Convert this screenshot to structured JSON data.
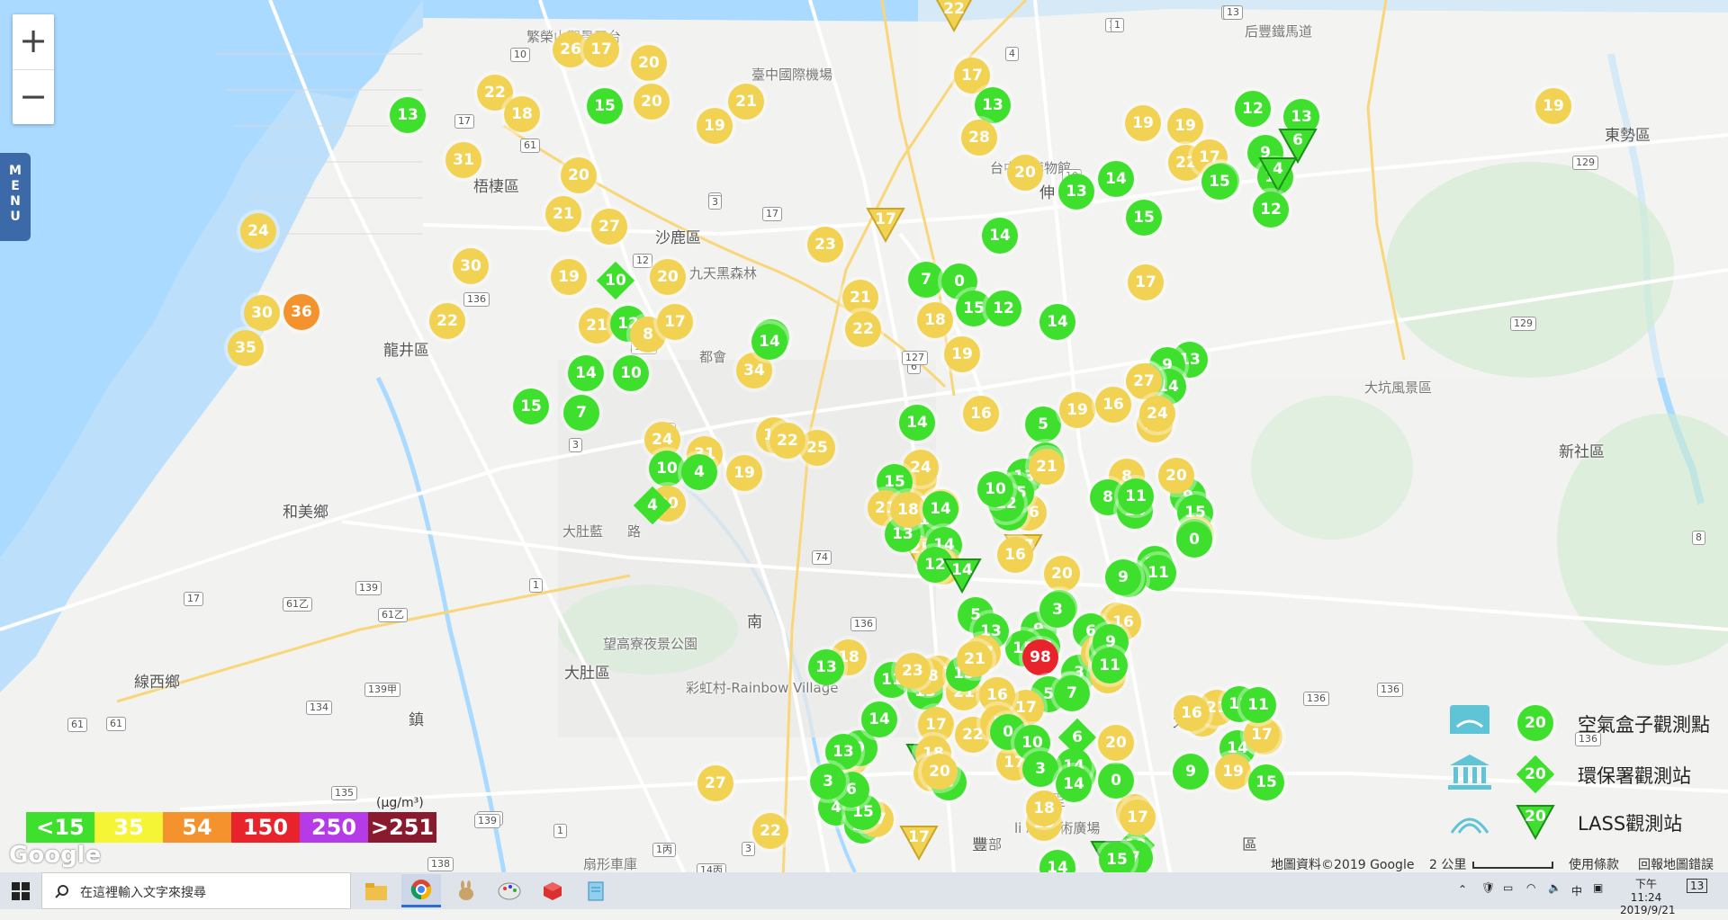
{
  "zoom": {
    "in_label": "+",
    "out_label": "−"
  },
  "menu": {
    "label": "MENU"
  },
  "places": [
    {
      "name": "繁榮山觀景平台",
      "cls": "small"
    },
    {
      "name": "臺中國際機場",
      "cls": "small"
    },
    {
      "name": "后豐鐵馬道",
      "cls": "small"
    },
    {
      "name": "東勢區",
      "cls": ""
    },
    {
      "name": "梧棲區",
      "cls": ""
    },
    {
      "name": "沙鹿區",
      "cls": ""
    },
    {
      "name": "台中球博物館",
      "cls": "small"
    },
    {
      "name": "九天黑森林",
      "cls": "small"
    },
    {
      "name": "龍井區",
      "cls": ""
    },
    {
      "name": "都會",
      "cls": "small"
    },
    {
      "name": "大坑風景區",
      "cls": "small"
    },
    {
      "name": "新社區",
      "cls": ""
    },
    {
      "name": "大肚藍",
      "cls": "small"
    },
    {
      "name": "路",
      "cls": "small"
    },
    {
      "name": "和美鄉",
      "cls": ""
    },
    {
      "name": "南",
      "cls": ""
    },
    {
      "name": "望高寮夜景公園",
      "cls": "small"
    },
    {
      "name": "大肚區",
      "cls": ""
    },
    {
      "name": "彩虹村-Rainbow Village",
      "cls": "small"
    },
    {
      "name": "線西鄉",
      "cls": ""
    },
    {
      "name": "鎮",
      "cls": ""
    },
    {
      "name": "太平",
      "cls": ""
    },
    {
      "name": "大里",
      "cls": ""
    },
    {
      "name": "li Art藝術廣場",
      "cls": "small"
    },
    {
      "name": "濟部",
      "cls": "small"
    },
    {
      "name": "扇形車庫",
      "cls": "small"
    },
    {
      "name": "伸",
      "cls": ""
    },
    {
      "name": "豐",
      "cls": ""
    },
    {
      "name": "區",
      "cls": ""
    }
  ],
  "shields": [
    "10",
    "17",
    "61",
    "136",
    "12",
    "1",
    "3",
    "17",
    "6",
    "127",
    "136",
    "12",
    "3",
    "74",
    "136",
    "1",
    "139",
    "61乙",
    "61乙",
    "17",
    "61",
    "134",
    "139甲",
    "135",
    "139",
    "1",
    "138",
    "1丙",
    "14丙",
    "3",
    "139",
    "129",
    "129",
    "136",
    "136",
    "136",
    "8",
    "13",
    "10",
    "4",
    "1",
    "3",
    "13",
    "61"
  ],
  "markers": [
    {
      "v": "26",
      "c": "y",
      "s": "c"
    },
    {
      "v": "17",
      "c": "y",
      "s": "c"
    },
    {
      "v": "20",
      "c": "y",
      "s": "c"
    },
    {
      "v": "20",
      "c": "y",
      "s": "c"
    },
    {
      "v": "21",
      "c": "y",
      "s": "c"
    },
    {
      "v": "19",
      "c": "y",
      "s": "c"
    },
    {
      "v": "22",
      "c": "y",
      "s": "c"
    },
    {
      "v": "18",
      "c": "y",
      "s": "c"
    },
    {
      "v": "13",
      "c": "g",
      "s": "c"
    },
    {
      "v": "15",
      "c": "g",
      "s": "c"
    },
    {
      "v": "31",
      "c": "y",
      "s": "c"
    },
    {
      "v": "20",
      "c": "y",
      "s": "c"
    },
    {
      "v": "21",
      "c": "y",
      "s": "c"
    },
    {
      "v": "27",
      "c": "y",
      "s": "c"
    },
    {
      "v": "24",
      "c": "y",
      "s": "c"
    },
    {
      "v": "30",
      "c": "y",
      "s": "c"
    },
    {
      "v": "19",
      "c": "y",
      "s": "c"
    },
    {
      "v": "10",
      "c": "g",
      "s": "d"
    },
    {
      "v": "20",
      "c": "y",
      "s": "c"
    },
    {
      "v": "30",
      "c": "y",
      "s": "c"
    },
    {
      "v": "36",
      "c": "o",
      "s": "c"
    },
    {
      "v": "35",
      "c": "y",
      "s": "c"
    },
    {
      "v": "22",
      "c": "y",
      "s": "c"
    },
    {
      "v": "21",
      "c": "y",
      "s": "c"
    },
    {
      "v": "12",
      "c": "g",
      "s": "c"
    },
    {
      "v": "8",
      "c": "y",
      "s": "c"
    },
    {
      "v": "17",
      "c": "y",
      "s": "c"
    },
    {
      "v": "15",
      "c": "g",
      "s": "c"
    },
    {
      "v": "10",
      "c": "g",
      "s": "c"
    },
    {
      "v": "14",
      "c": "g",
      "s": "c"
    },
    {
      "v": "15",
      "c": "g",
      "s": "c"
    },
    {
      "v": "7",
      "c": "g",
      "s": "c"
    },
    {
      "v": "19",
      "c": "y",
      "s": "c"
    },
    {
      "v": "34",
      "c": "y",
      "s": "c"
    },
    {
      "v": "14",
      "c": "g",
      "s": "c"
    },
    {
      "v": "22",
      "c": "y",
      "s": "t"
    },
    {
      "v": "17",
      "c": "y",
      "s": "c"
    },
    {
      "v": "13",
      "c": "g",
      "s": "c"
    },
    {
      "v": "28",
      "c": "y",
      "s": "c"
    },
    {
      "v": "20",
      "c": "y",
      "s": "c"
    },
    {
      "v": "13",
      "c": "g",
      "s": "c"
    },
    {
      "v": "19",
      "c": "y",
      "s": "c"
    },
    {
      "v": "19",
      "c": "y",
      "s": "c"
    },
    {
      "v": "22",
      "c": "y",
      "s": "c"
    },
    {
      "v": "12",
      "c": "g",
      "s": "c"
    },
    {
      "v": "13",
      "c": "g",
      "s": "c"
    },
    {
      "v": "9",
      "c": "g",
      "s": "c"
    },
    {
      "v": "6",
      "c": "g",
      "s": "t"
    },
    {
      "v": "17",
      "c": "y",
      "s": "c"
    },
    {
      "v": "13",
      "c": "g",
      "s": "c"
    },
    {
      "v": "12",
      "c": "g",
      "s": "c"
    },
    {
      "v": "4",
      "c": "g",
      "s": "t"
    },
    {
      "v": "12",
      "c": "g",
      "s": "c"
    },
    {
      "v": "15",
      "c": "g",
      "s": "c"
    },
    {
      "v": "15",
      "c": "g",
      "s": "c"
    },
    {
      "v": "14",
      "c": "g",
      "s": "c"
    },
    {
      "v": "19",
      "c": "y",
      "s": "c"
    },
    {
      "v": "23",
      "c": "y",
      "s": "c"
    },
    {
      "v": "17",
      "c": "y",
      "s": "t"
    },
    {
      "v": "14",
      "c": "g",
      "s": "c"
    },
    {
      "v": "7",
      "c": "g",
      "s": "c"
    },
    {
      "v": "0",
      "c": "g",
      "s": "c"
    },
    {
      "v": "21",
      "c": "y",
      "s": "c"
    },
    {
      "v": "22",
      "c": "y",
      "s": "c"
    },
    {
      "v": "15",
      "c": "g",
      "s": "c"
    },
    {
      "v": "12",
      "c": "g",
      "s": "c"
    },
    {
      "v": "18",
      "c": "y",
      "s": "c"
    },
    {
      "v": "19",
      "c": "y",
      "s": "c"
    },
    {
      "v": "14",
      "c": "g",
      "s": "c"
    },
    {
      "v": "17",
      "c": "y",
      "s": "c"
    },
    {
      "v": "13",
      "c": "g",
      "s": "c"
    },
    {
      "v": "9",
      "c": "g",
      "s": "c"
    },
    {
      "v": "14",
      "c": "g",
      "s": "c"
    },
    {
      "v": "14",
      "c": "g",
      "s": "c"
    },
    {
      "v": "27",
      "c": "y",
      "s": "c"
    },
    {
      "v": "16",
      "c": "y",
      "s": "c"
    },
    {
      "v": "5",
      "c": "g",
      "s": "c"
    },
    {
      "v": "19",
      "c": "y",
      "s": "c"
    },
    {
      "v": "16",
      "c": "y",
      "s": "c"
    },
    {
      "v": "17",
      "c": "y",
      "s": "c"
    },
    {
      "v": "14",
      "c": "g",
      "s": "c"
    },
    {
      "v": "19",
      "c": "y",
      "s": "c"
    },
    {
      "v": "31",
      "c": "y",
      "s": "c"
    },
    {
      "v": "24",
      "c": "y",
      "s": "c"
    },
    {
      "v": "10",
      "c": "g",
      "s": "c"
    },
    {
      "v": "4",
      "c": "g",
      "s": "c"
    },
    {
      "v": "8",
      "c": "y",
      "s": "c"
    },
    {
      "v": "24",
      "c": "y",
      "s": "c"
    },
    {
      "v": "25",
      "c": "y",
      "s": "c"
    },
    {
      "v": "22",
      "c": "y",
      "s": "c"
    },
    {
      "v": "19",
      "c": "y",
      "s": "c"
    },
    {
      "v": "20",
      "c": "y",
      "s": "c"
    },
    {
      "v": "4",
      "c": "g",
      "s": "d"
    },
    {
      "v": "25",
      "c": "y",
      "s": "t"
    },
    {
      "v": "24",
      "c": "y",
      "s": "c"
    },
    {
      "v": "15",
      "c": "g",
      "s": "c"
    },
    {
      "v": "21",
      "c": "y",
      "s": "c"
    },
    {
      "v": "18",
      "c": "y",
      "s": "c"
    },
    {
      "v": "11",
      "c": "g",
      "s": "c"
    },
    {
      "v": "13",
      "c": "g",
      "s": "c"
    },
    {
      "v": "18",
      "c": "y",
      "s": "c"
    },
    {
      "v": "14",
      "c": "g",
      "s": "c"
    },
    {
      "v": "14",
      "c": "g",
      "s": "c"
    },
    {
      "v": "19",
      "c": "y",
      "s": "c"
    },
    {
      "v": "16",
      "c": "y",
      "s": "c"
    },
    {
      "v": "10",
      "c": "g",
      "s": "c"
    },
    {
      "v": "2",
      "c": "g",
      "s": "c"
    },
    {
      "v": "13",
      "c": "g",
      "s": "c"
    },
    {
      "v": "15",
      "c": "g",
      "s": "c"
    },
    {
      "v": "12",
      "c": "g",
      "s": "c"
    },
    {
      "v": "21",
      "c": "y",
      "s": "c"
    },
    {
      "v": "10",
      "c": "g",
      "s": "c"
    },
    {
      "v": "12",
      "c": "g",
      "s": "c"
    },
    {
      "v": "20",
      "c": "y",
      "s": "c"
    },
    {
      "v": "17",
      "c": "y",
      "s": "t"
    },
    {
      "v": "14",
      "c": "g",
      "s": "t"
    },
    {
      "v": "16",
      "c": "y",
      "s": "c"
    },
    {
      "v": "8",
      "c": "g",
      "s": "c"
    },
    {
      "v": "14",
      "c": "g",
      "s": "c"
    },
    {
      "v": "11",
      "c": "g",
      "s": "c"
    },
    {
      "v": "12",
      "c": "g",
      "s": "c"
    },
    {
      "v": "11",
      "c": "g",
      "s": "c"
    },
    {
      "v": "9",
      "c": "g",
      "s": "c"
    },
    {
      "v": "15",
      "c": "g",
      "s": "c"
    },
    {
      "v": "21",
      "c": "y",
      "s": "c"
    },
    {
      "v": "13",
      "c": "g",
      "s": "c"
    },
    {
      "v": "0",
      "c": "g",
      "s": "c"
    },
    {
      "v": "20",
      "c": "y",
      "s": "c"
    },
    {
      "v": "20",
      "c": "y",
      "s": "c"
    },
    {
      "v": "16",
      "c": "y",
      "s": "c"
    },
    {
      "v": "6",
      "c": "g",
      "s": "c"
    },
    {
      "v": "9",
      "c": "g",
      "s": "c"
    },
    {
      "v": "4",
      "c": "g",
      "s": "c"
    },
    {
      "v": "13",
      "c": "g",
      "s": "c"
    },
    {
      "v": "15",
      "c": "g",
      "s": "c"
    },
    {
      "v": "5",
      "c": "g",
      "s": "c"
    },
    {
      "v": "98",
      "c": "r",
      "s": "c"
    },
    {
      "v": "3",
      "c": "g",
      "s": "c"
    },
    {
      "v": "8",
      "c": "y",
      "s": "c"
    },
    {
      "v": "11",
      "c": "g",
      "s": "c"
    },
    {
      "v": "9",
      "c": "g",
      "s": "c"
    },
    {
      "v": "9",
      "c": "g",
      "s": "c"
    },
    {
      "v": "3",
      "c": "g",
      "s": "c"
    },
    {
      "v": "9",
      "c": "g",
      "s": "c"
    },
    {
      "v": "11",
      "c": "g",
      "s": "c"
    },
    {
      "v": "16",
      "c": "y",
      "s": "c"
    },
    {
      "v": "13",
      "c": "g",
      "s": "c"
    },
    {
      "v": "21",
      "c": "y",
      "s": "c"
    },
    {
      "v": "18",
      "c": "y",
      "s": "c"
    },
    {
      "v": "13",
      "c": "g",
      "s": "c"
    },
    {
      "v": "27",
      "c": "y",
      "s": "c"
    },
    {
      "v": "17",
      "c": "y",
      "s": "c"
    },
    {
      "v": "18",
      "c": "y",
      "s": "c"
    },
    {
      "v": "13",
      "c": "g",
      "s": "c"
    },
    {
      "v": "23",
      "c": "y",
      "s": "c"
    },
    {
      "v": "15",
      "c": "g",
      "s": "c"
    },
    {
      "v": "13",
      "c": "g",
      "s": "c"
    },
    {
      "v": "5",
      "c": "g",
      "s": "c"
    },
    {
      "v": "7",
      "c": "g",
      "s": "c"
    },
    {
      "v": "27",
      "c": "y",
      "s": "c"
    },
    {
      "v": "17",
      "c": "y",
      "s": "c"
    },
    {
      "v": "21",
      "c": "y",
      "s": "c"
    },
    {
      "v": "16",
      "c": "y",
      "s": "c"
    },
    {
      "v": "11",
      "c": "g",
      "s": "c"
    },
    {
      "v": "17",
      "c": "y",
      "s": "c"
    },
    {
      "v": "14",
      "c": "g",
      "s": "t"
    },
    {
      "v": "18",
      "c": "y",
      "s": "c"
    },
    {
      "v": "17",
      "c": "y",
      "s": "c"
    },
    {
      "v": "22",
      "c": "y",
      "s": "c"
    },
    {
      "v": "5",
      "c": "y",
      "s": "c"
    },
    {
      "v": "0",
      "c": "g",
      "s": "c"
    },
    {
      "v": "8",
      "c": "g",
      "s": "c"
    },
    {
      "v": "20",
      "c": "y",
      "s": "c"
    },
    {
      "v": "10",
      "c": "g",
      "s": "c"
    },
    {
      "v": "13",
      "c": "g",
      "s": "c"
    },
    {
      "v": "14",
      "c": "g",
      "s": "c"
    },
    {
      "v": "3",
      "c": "g",
      "s": "c"
    },
    {
      "v": "6",
      "c": "g",
      "s": "d"
    },
    {
      "v": "23",
      "c": "y",
      "s": "c"
    },
    {
      "v": "9",
      "c": "g",
      "s": "c"
    },
    {
      "v": "4",
      "c": "g",
      "s": "c"
    },
    {
      "v": "15",
      "c": "g",
      "s": "c"
    },
    {
      "v": "17",
      "c": "y",
      "s": "c"
    },
    {
      "v": "15",
      "c": "g",
      "s": "c"
    },
    {
      "v": "6",
      "c": "g",
      "s": "c"
    },
    {
      "v": "13",
      "c": "g",
      "s": "c"
    },
    {
      "v": "14",
      "c": "g",
      "s": "c"
    },
    {
      "v": "3",
      "c": "g",
      "s": "c"
    },
    {
      "v": "27",
      "c": "y",
      "s": "c"
    },
    {
      "v": "22",
      "c": "y",
      "s": "c"
    },
    {
      "v": "17",
      "c": "y",
      "s": "t"
    },
    {
      "v": "19",
      "c": "y",
      "s": "c"
    },
    {
      "v": "13",
      "c": "g",
      "s": "d"
    },
    {
      "v": "4",
      "c": "g",
      "s": "t"
    },
    {
      "v": "7",
      "c": "g",
      "s": "c"
    },
    {
      "v": "14",
      "c": "g",
      "s": "c"
    },
    {
      "v": "15",
      "c": "g",
      "s": "c"
    },
    {
      "v": "19",
      "c": "y",
      "s": "c"
    },
    {
      "v": "0",
      "c": "g",
      "s": "c"
    },
    {
      "v": "18",
      "c": "y",
      "s": "c"
    },
    {
      "v": "20",
      "c": "y",
      "s": "c"
    },
    {
      "v": "14",
      "c": "g",
      "s": "c"
    },
    {
      "v": "24",
      "c": "y",
      "s": "c"
    },
    {
      "v": "14",
      "c": "g",
      "s": "c"
    },
    {
      "v": "19",
      "c": "y",
      "s": "c"
    },
    {
      "v": "21",
      "c": "y",
      "s": "c"
    },
    {
      "v": "28",
      "c": "y",
      "s": "c"
    },
    {
      "v": "17",
      "c": "y",
      "s": "c"
    },
    {
      "v": "12",
      "c": "g",
      "s": "c"
    },
    {
      "v": "11",
      "c": "g",
      "s": "c"
    },
    {
      "v": "9",
      "c": "g",
      "s": "c"
    },
    {
      "v": "16",
      "c": "y",
      "s": "c"
    },
    {
      "v": "15",
      "c": "g",
      "s": "c"
    },
    {
      "v": "17",
      "c": "y",
      "s": "c"
    },
    {
      "v": "15",
      "c": "g",
      "s": "c"
    }
  ],
  "legend_bar": [
    {
      "label": "<15",
      "color": "#3fe02d"
    },
    {
      "label": "35",
      "color": "#f5f536"
    },
    {
      "label": "54",
      "color": "#f4922e"
    },
    {
      "label": "150",
      "color": "#e8232b"
    },
    {
      "label": "250",
      "color": "#b53ae8"
    },
    {
      "label": ">251",
      "color": "#8a1a2e"
    }
  ],
  "unit": "(μg/m³)",
  "google_logo": "Google",
  "legend_right": {
    "airbox": {
      "value": "20",
      "label": "空氣盒子觀測點"
    },
    "epa": {
      "value": "20",
      "label": "環保署觀測站"
    },
    "lass": {
      "value": "20",
      "label": "LASS觀測站"
    }
  },
  "attribution": {
    "data": "地圖資料©2019 Google",
    "scale": "2 公里",
    "terms": "使用條款",
    "report": "回報地圖錯誤"
  },
  "taskbar": {
    "search_placeholder": "在這裡輸入文字來搜尋",
    "ime": "中",
    "time": "下午 11:24",
    "date": "2019/9/21",
    "notif_count": "13"
  }
}
